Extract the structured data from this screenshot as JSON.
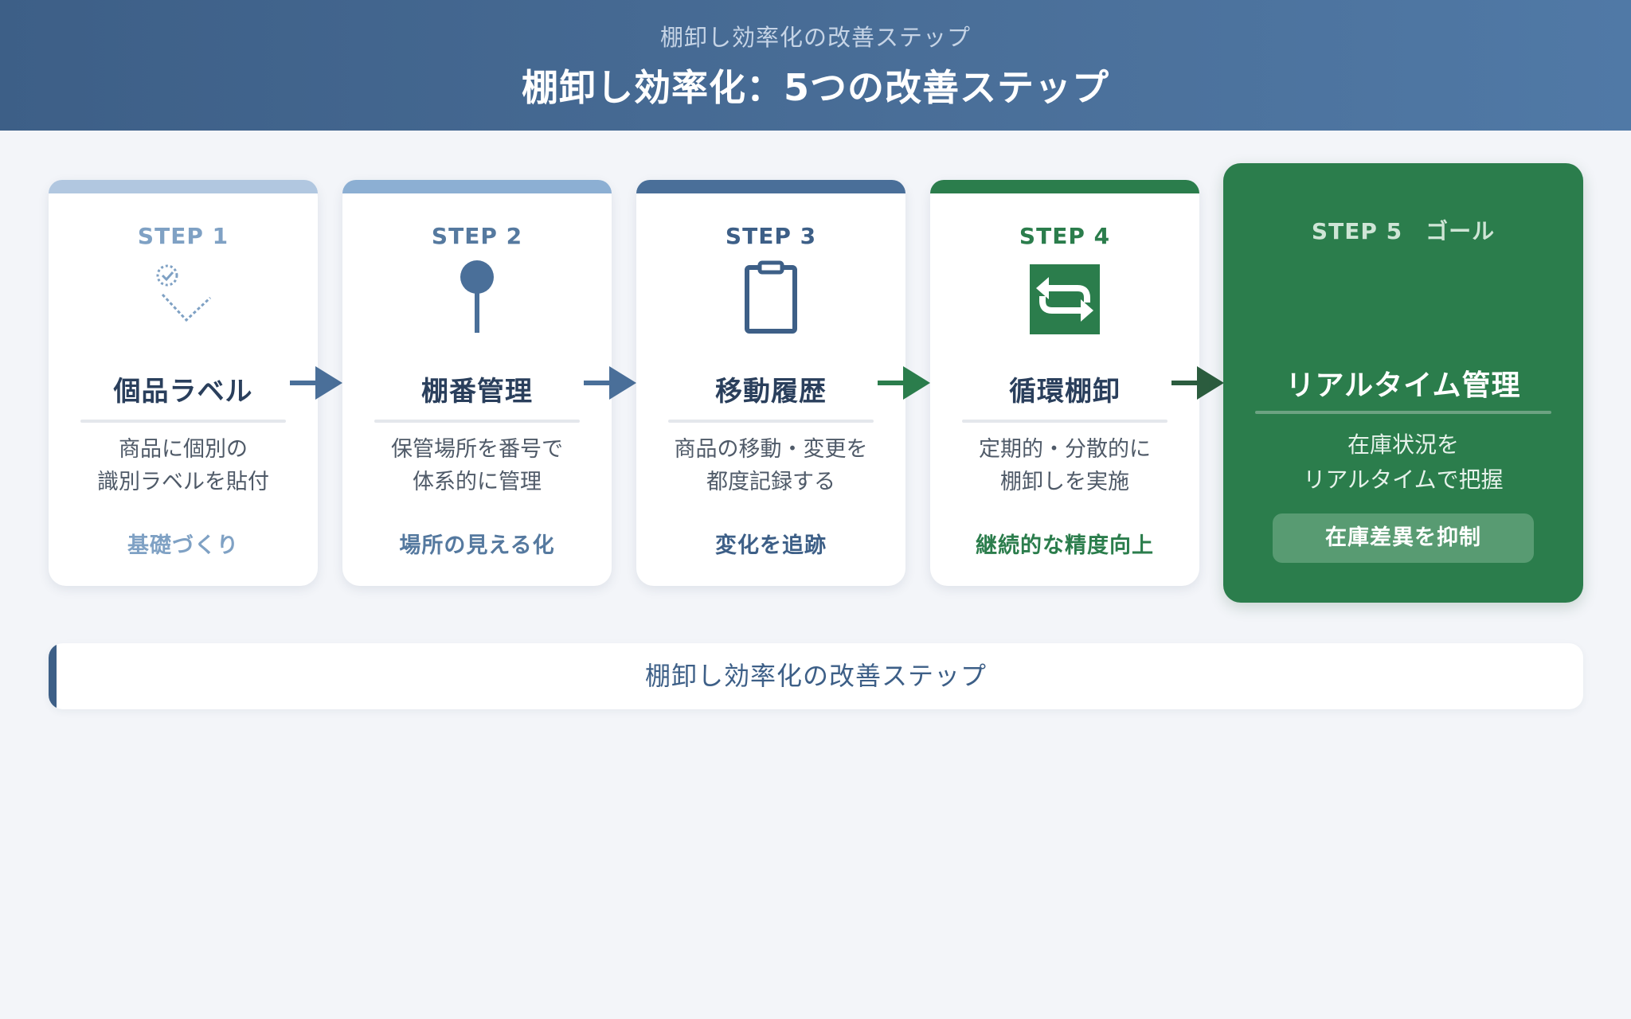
{
  "header": {
    "subtitle": "棚卸し効率化の改善ステップ",
    "title": "棚卸し効率化：5つの改善ステップ"
  },
  "colors": {
    "step1": "#7fa1c4",
    "step2": "#55799f",
    "step3": "#3d5f87",
    "step4": "#2b7d4c",
    "goal": "#2b7d4c"
  },
  "steps": [
    {
      "label": "STEP 1",
      "icon": "tag-check-icon",
      "title": "個品ラベル",
      "desc_line1": "商品に個別の",
      "desc_line2": "識別ラベルを貼付",
      "result": "基礎づくり"
    },
    {
      "label": "STEP 2",
      "icon": "location-pin-icon",
      "title": "棚番管理",
      "desc_line1": "保管場所を番号で",
      "desc_line2": "体系的に管理",
      "result": "場所の見える化"
    },
    {
      "label": "STEP 3",
      "icon": "clipboard-icon",
      "title": "移動履歴",
      "desc_line1": "商品の移動・変更を",
      "desc_line2": "都度記録する",
      "result": "変化を追跡"
    },
    {
      "label": "STEP 4",
      "icon": "cycle-arrows-icon",
      "title": "循環棚卸",
      "desc_line1": "定期的・分散的に",
      "desc_line2": "棚卸しを実施",
      "result": "継続的な精度向上"
    }
  ],
  "goal": {
    "label": "STEP 5　ゴール",
    "title": "リアルタイム管理",
    "desc_line1": "在庫状況を",
    "desc_line2": "リアルタイムで把握",
    "badge": "在庫差異を抑制"
  },
  "footer": {
    "text": "棚卸し効率化の改善ステップ"
  }
}
